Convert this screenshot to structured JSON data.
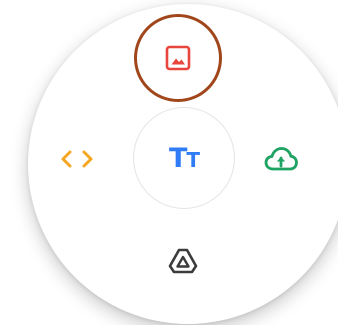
{
  "menu": {
    "top_item": {
      "icon": "image-icon",
      "color": "#e8453c",
      "highlight_color": "#a0461a"
    },
    "left_item": {
      "icon": "code-icon",
      "color": "#f5a623"
    },
    "right_item": {
      "icon": "cloud-upload-icon",
      "color": "#1ea362"
    },
    "bottom_item": {
      "icon": "drive-icon",
      "color": "#3c3c3c"
    },
    "center_button": {
      "label_big": "T",
      "label_small": "T",
      "color": "#2f7cf6"
    }
  }
}
